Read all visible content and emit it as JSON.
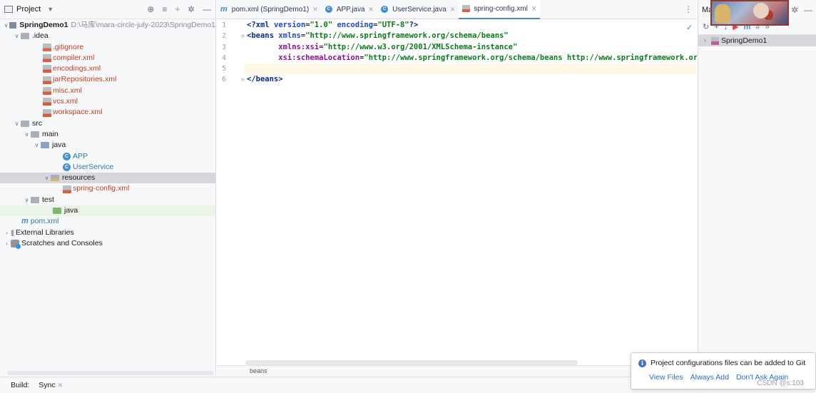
{
  "project_panel": {
    "title": "Project",
    "tree": [
      {
        "label": "SpringDemo1",
        "path": "D:\\马库\\mara-circle-july-2023\\SpringDemo1"
      },
      {
        "label": ".idea"
      },
      {
        "label": ".gitignore"
      },
      {
        "label": "compiler.xml"
      },
      {
        "label": "encodings.xml"
      },
      {
        "label": "jarRepositories.xml"
      },
      {
        "label": "misc.xml"
      },
      {
        "label": "vcs.xml"
      },
      {
        "label": "workspace.xml"
      },
      {
        "label": "src"
      },
      {
        "label": "main"
      },
      {
        "label": "java"
      },
      {
        "label": "APP"
      },
      {
        "label": "UserService"
      },
      {
        "label": "resources"
      },
      {
        "label": "spring-config.xml"
      },
      {
        "label": "test"
      },
      {
        "label": "java"
      },
      {
        "label": "pom.xml"
      },
      {
        "label": "External Libraries"
      },
      {
        "label": "Scratches and Consoles"
      }
    ]
  },
  "editor": {
    "tabs": [
      {
        "label": "pom.xml (SpringDemo1)"
      },
      {
        "label": "APP.java"
      },
      {
        "label": "UserService.java"
      },
      {
        "label": "spring-config.xml"
      }
    ],
    "line_numbers": [
      "1",
      "2",
      "3",
      "4",
      "5",
      "6"
    ],
    "code": {
      "l1_decl_open": "<?",
      "l1_xml": "xml",
      "l1_version_attr": " version",
      "l1_eq1": "=",
      "l1_version_val": "\"1.0\"",
      "l1_encoding_attr": " encoding",
      "l1_eq2": "=",
      "l1_encoding_val": "\"UTF-8\"",
      "l1_decl_close": "?>",
      "l2_open": "<beans",
      "l2_attr": " xmlns",
      "l2_eq": "=",
      "l2_val": "\"http://www.springframework.org/schema/beans\"",
      "l3_indent": "       ",
      "l3_ns": "xmlns:xsi",
      "l3_eq": "=",
      "l3_val": "\"http://www.w3.org/2001/XMLSchema-instance\"",
      "l4_indent": "       ",
      "l4_ns": "xsi:schemaLocation",
      "l4_eq": "=",
      "l4_val": "\"http://www.springframework.org/schema/beans http://www.springframework.org/sc",
      "l6_close": "</beans>"
    },
    "breadcrumb": "beans"
  },
  "right_panel": {
    "title_fragment": "Ma",
    "maven_project": "SpringDemo1"
  },
  "bottom_bar": {
    "build_label": "Build:",
    "sync_label": "Sync"
  },
  "notification": {
    "message": "Project configurations files can be added to Git",
    "actions": [
      "View Files",
      "Always Add",
      "Don't Ask Again"
    ],
    "watermark": "CSDN @s:103"
  },
  "icons": {
    "info": "info-icon",
    "settings": "gear-icon",
    "minimize": "minimize-icon"
  }
}
